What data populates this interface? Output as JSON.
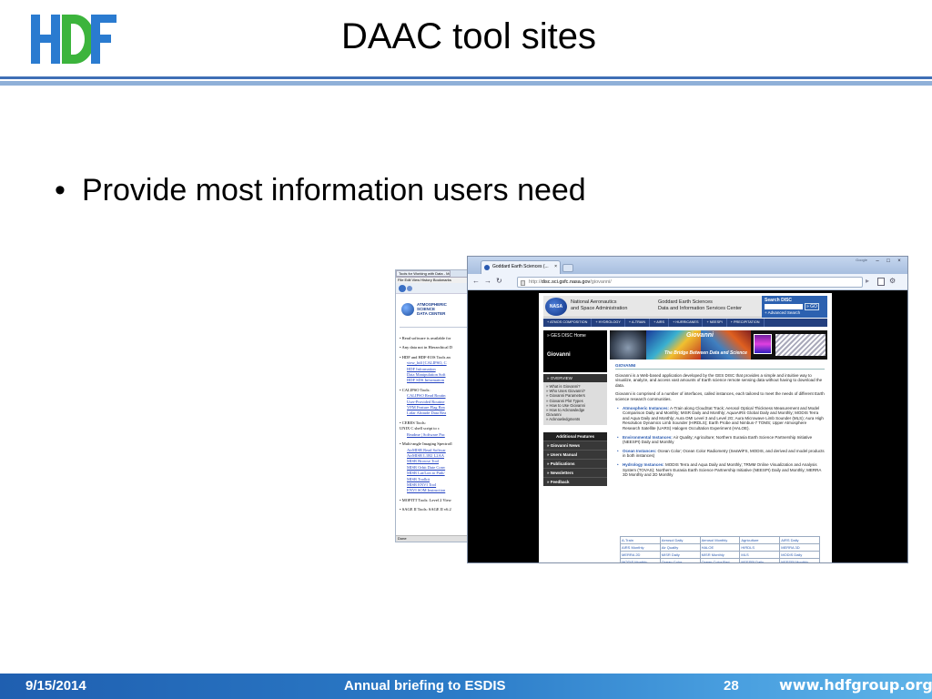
{
  "slide": {
    "title": "DAAC tool sites",
    "bullet": "Provide most information users need",
    "footer": {
      "date": "9/15/2014",
      "center": "Annual briefing to ESDIS",
      "page": "28",
      "url": "www.hdfgroup.org"
    },
    "colors": {
      "footer_blue": "#2c7cc8",
      "header_rule": "#3f6fb5",
      "logo_blue": "#2a7bd0",
      "logo_green": "#3cb43c"
    }
  },
  "back_browser": {
    "tab_title": "Tools for Working with Data - Mozilla F",
    "menu": "File  Edit  View  History  Bookmarks",
    "logo_lines": [
      "ATMOSPHERIC",
      "SCIENCE",
      "DATA CENTER"
    ],
    "content_lines": [
      {
        "text": "• Read software is available for",
        "link": false
      },
      {
        "text": "",
        "link": false
      },
      {
        "text": "• Any data not in Hierarchical D",
        "link": false
      },
      {
        "text": "",
        "link": false
      },
      {
        "text": "• HDF and HDF-EOS Tools an",
        "link": false
      },
      {
        "text": "view_hdf [CALIPSO, C",
        "link": true
      },
      {
        "text": "HDF Information",
        "link": true
      },
      {
        "text": "Data Manipulation Soft",
        "link": true
      },
      {
        "text": "HDF SDS Information",
        "link": true
      },
      {
        "text": "",
        "link": false
      },
      {
        "text": "• CALIPSO Tools:",
        "link": false
      },
      {
        "text": "CALIPSO Read Routin",
        "link": true
      },
      {
        "text": "User-Provided Routine",
        "link": true
      },
      {
        "text": "VFM Feature Flag Rea",
        "link": true
      },
      {
        "text": "Lidar Altitude Data Rea",
        "link": true
      },
      {
        "text": "",
        "link": false
      },
      {
        "text": "• CERES Tools:",
        "link": false
      },
      {
        "text": "UNIX C shell script to c",
        "link": false
      },
      {
        "text": "Readme | Software Pac",
        "link": true
      },
      {
        "text": "",
        "link": false
      },
      {
        "text": "• Multi-angle Imaging Spectrofl",
        "link": false
      },
      {
        "text": "AirMISR Read Softwar",
        "link": true
      },
      {
        "text": "AirMISR L1B2 L2AA",
        "link": true
      },
      {
        "text": "MISR Browse Tool",
        "link": true
      },
      {
        "text": "MISR Orbit Date Conv",
        "link": true
      },
      {
        "text": "MISR Lat/Lon to Path/",
        "link": true
      },
      {
        "text": "MISR Toolkit",
        "link": true
      },
      {
        "text": "MISR ENVI Tool",
        "link": true
      },
      {
        "text": "ENVI SOM Instruction",
        "link": true
      },
      {
        "text": "",
        "link": false
      },
      {
        "text": "• MOPITT Tools: Level 2 View",
        "link": false
      },
      {
        "text": "",
        "link": false
      },
      {
        "text": "• SAGE II Tools: SAGE II v6.2",
        "link": false
      }
    ],
    "status": "Done"
  },
  "front_browser": {
    "tab_title": "Goddard Earth Sciences (...",
    "google_label": "Google",
    "address": {
      "scheme": "http://",
      "host": "disc.sci.gsfc.nasa.gov",
      "path": "/giovanni/"
    },
    "header": {
      "nasa_logo": "NASA",
      "nasa_name": [
        "National Aeronautics",
        "and Space Administration"
      ],
      "center_name": [
        "Goddard Earth Sciences",
        "Data and Information Services Center"
      ],
      "search_label": "Search DISC",
      "go": "» GO",
      "advanced": "+ Advanced Search"
    },
    "nav": [
      "+ ATMOS COMPOSITION",
      "+ HYDROLOGY",
      "+ A-TRAIN",
      "+ AIRS",
      "+ HURRICANES",
      "+ NEESPI",
      "+ PRECIPITATION"
    ],
    "left_panel": {
      "home": "» GES DISC Home",
      "giovanni": "Giovanni",
      "overview": "» OVERVIEW",
      "sub_items": [
        "» What is Giovanni?",
        "» Who Uses Giovanni?",
        "» Giovanni Parameters",
        "» Giovanni Plot Types",
        "» How to Use Giovanni",
        "» How to Acknowledge",
        "   Giovanni",
        "» Acknowledgments"
      ],
      "additional": "Additional Features",
      "items": [
        "» Giovanni News",
        "» Users Manual",
        "» Publications",
        "» Newsletters",
        "» Feedback"
      ]
    },
    "banner": {
      "title": "Giovanni",
      "subtitle": "The Bridge Between Data and Science"
    },
    "main": {
      "section": "GIOVANNI",
      "para1": "Giovanni is a Web-based application developed by the GES DISC that provides a simple and intuitive way to visualize, analyze, and access vast amounts of Earth science remote sensing data without having to download the data.",
      "para2": "Giovanni is comprised of a number of interfaces, called instances, each tailored to meet the needs of different Earth science research communities.",
      "list": [
        {
          "title": "Atmospheric Instances:",
          "text": " A-Train along CloudSat Track; Aerosol Optical Thickness Measurement and Model Comparison Daily and Monthly; MISR Daily and Monthly; AquaAIRS Global Daily and Monthly; MODIS Terra and Aqua Daily and Monthly; Aura OMI Level 3 and Level 2G; Aura Microwave Limb Sounder (MLS); Aura High Resolution Dynamics Limb Sounder (HIRDLS); Earth Probe and Nimbus-7 TOMS; Upper Atmosphere Research Satellite (UARS) Halogen Occultation Experiment (HALOE)."
        },
        {
          "title": "Environmental Instances:",
          "text": " Air Quality; Agriculture; Northern Eurasia Earth Science Partnership Initiative (NEESPI) Daily and Monthly"
        },
        {
          "title": "Ocean Instances:",
          "text": " Ocean Color; Ocean Color Radiometry (SeaWiFS, MODIS, and derived and model products in both instances)"
        },
        {
          "title": "Hydrology Instances:",
          "text": " MODIS Terra and Aqua Daily and Monthly; TRMM Online Visualization and Analysis System (TOVAS); Northern Eurasia Earth Science Partnership Initiative (NEESPI) Daily and Monthly; MERRA 3D Monthly and 2D Monthly"
        }
      ]
    },
    "table": [
      [
        "A-Train",
        "Aerosol Daily",
        "Aerosol Monthly",
        "Agriculture",
        "AIRS Daily"
      ],
      [
        "AIRS Monthly",
        "Air Quality",
        "HALOE",
        "HIRDLS",
        "MERRA 3D"
      ],
      [
        "MERRA 2D",
        "MISR Daily",
        "MISR Monthly",
        "MLS",
        "MODIS Daily"
      ],
      [
        "MODIS Monthly",
        "Ocean Color",
        "Ocean Color Rad",
        "NEESPI Daily",
        "NEESPI Monthly"
      ],
      [
        "OMI",
        "OMI L2G",
        "TOMS",
        "TRMM",
        ""
      ]
    ]
  }
}
